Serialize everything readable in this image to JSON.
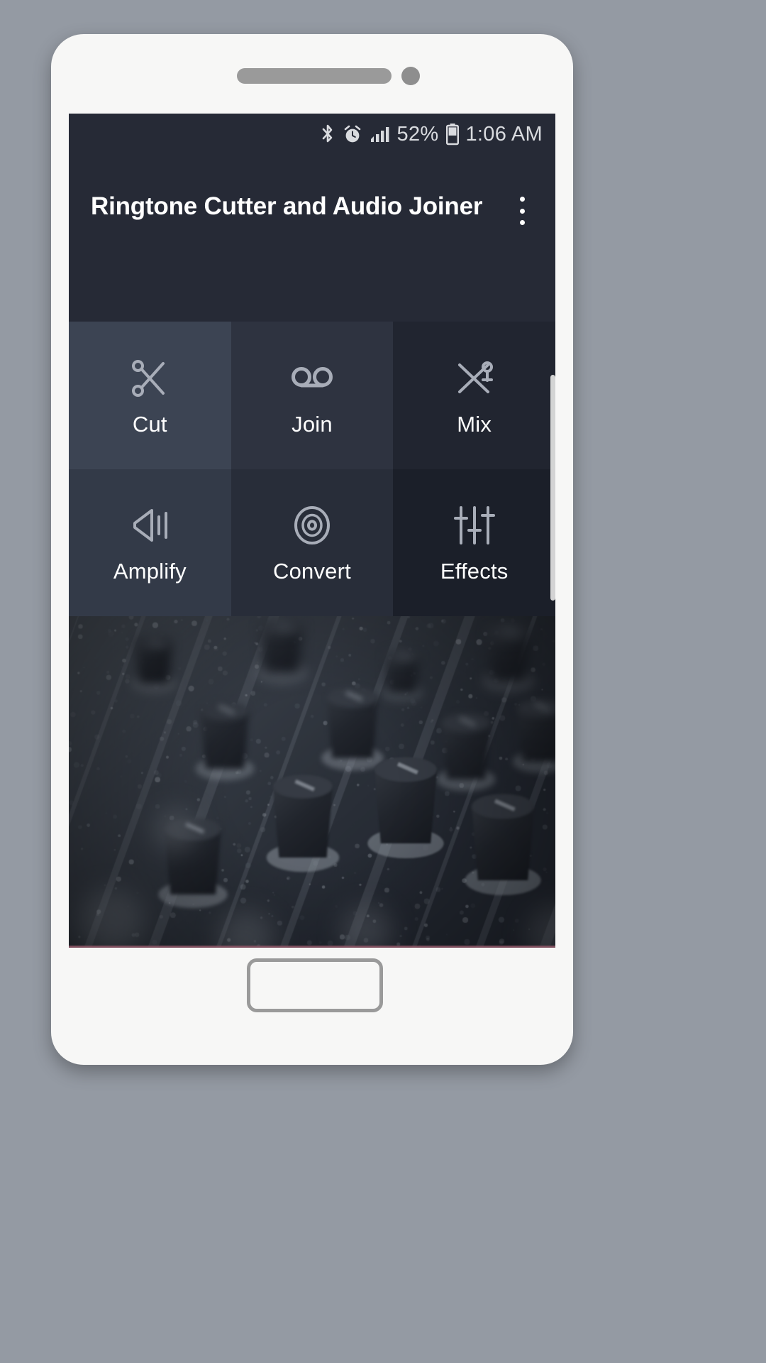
{
  "device": {
    "frame_color": "#f7f7f6",
    "background_color": "#949aa3",
    "speaker_icon": "speaker-grille",
    "camera_icon": "front-camera-dot",
    "home_button_icon": "home-button"
  },
  "status_bar": {
    "bluetooth_icon": "bluetooth-icon",
    "alarm_icon": "alarm-clock-icon",
    "signal_icon": "cellular-signal-icon",
    "battery_percent": "52%",
    "battery_icon": "battery-icon",
    "battery_level": 52,
    "time": "1:06 AM",
    "text_color": "#d9dbdf"
  },
  "app_bar": {
    "title": "Ringtone Cutter and Audio Joiner",
    "overflow_icon": "overflow-menu-icon",
    "background_color": "#262a36",
    "title_color": "#ffffff"
  },
  "tiles": [
    {
      "label": "Cut",
      "icon": "scissors-icon",
      "bg": "#3c4453"
    },
    {
      "label": "Join",
      "icon": "voicemail-icon",
      "bg": "#2e3340"
    },
    {
      "label": "Mix",
      "icon": "shuffle-mix-icon",
      "bg": "#212530"
    },
    {
      "label": "Amplify",
      "icon": "volume-up-icon",
      "bg": "#333a48"
    },
    {
      "label": "Convert",
      "icon": "disc-record-icon",
      "bg": "#282d39"
    },
    {
      "label": "Effects",
      "icon": "equalizer-icon",
      "bg": "#1b1f29"
    }
  ],
  "photo": {
    "description": "audio mixer knobs",
    "accent_line_color": "#8e5666"
  },
  "scrollbar": {
    "thumb_color": "#e3e3e3"
  }
}
